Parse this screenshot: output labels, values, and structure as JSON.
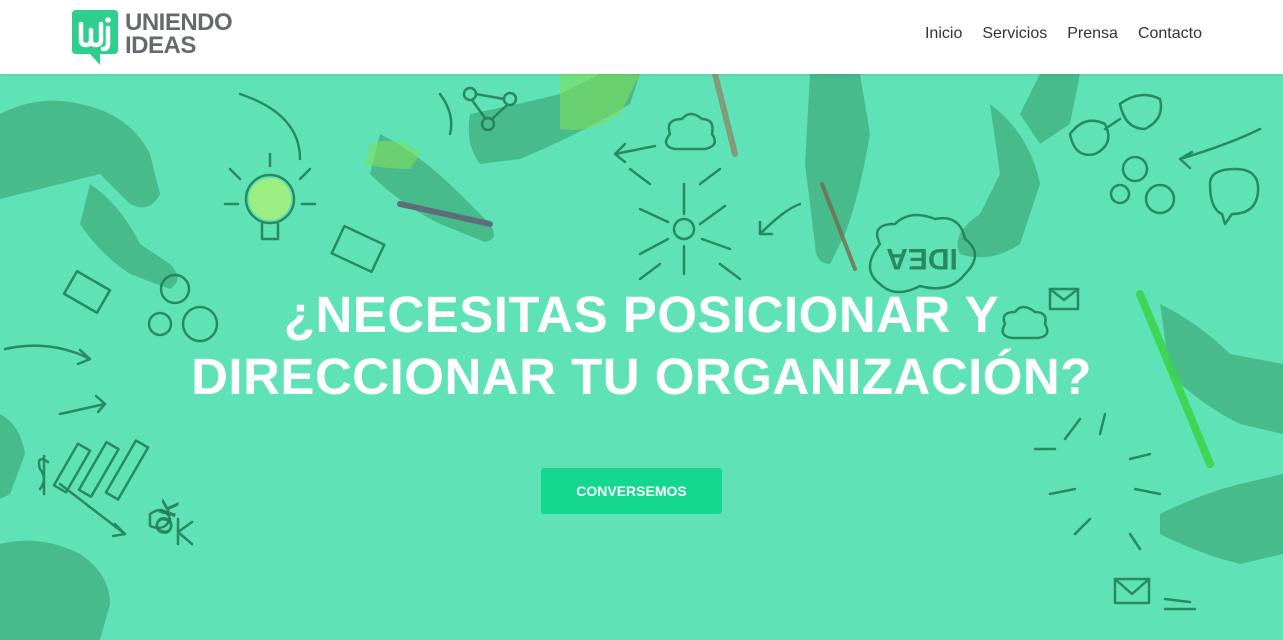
{
  "brand": {
    "name_line1": "UNIENDO",
    "name_line2": "IDEAS",
    "logo_color": "#2ecf8e",
    "text_color": "#666a6e"
  },
  "nav": {
    "items": [
      {
        "label": "Inicio"
      },
      {
        "label": "Servicios"
      },
      {
        "label": "Prensa"
      },
      {
        "label": "Contacto"
      }
    ]
  },
  "hero": {
    "headline_line1": "¿NECESITAS POSICIONAR Y",
    "headline_line2": "DIRECCIONAR TU ORGANIZACIÓN?",
    "cta_label": "CONVERSEMOS",
    "doodle_text": "IDEA",
    "doodle_text_2": "OK",
    "background_color": "#5fe3b6",
    "cta_color": "#14d88f"
  }
}
